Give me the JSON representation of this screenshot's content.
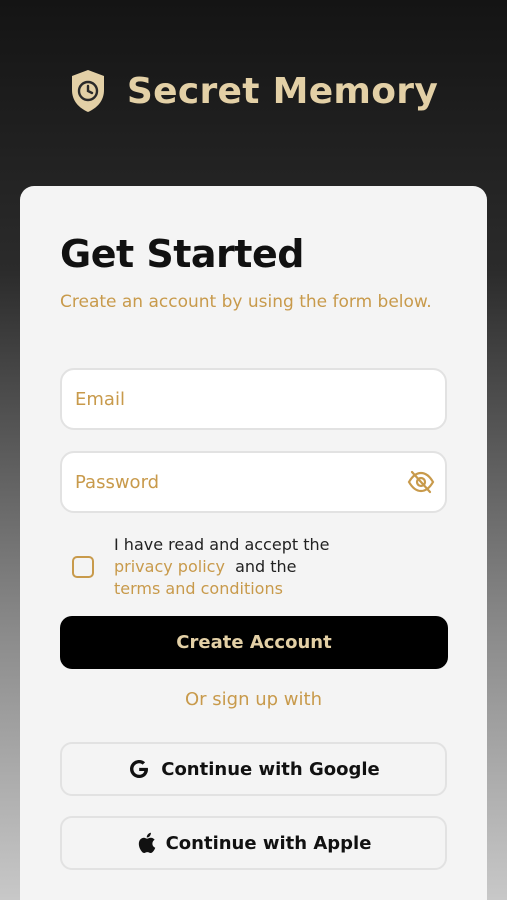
{
  "app": {
    "title": "Secret Memory",
    "logo_icon": "shield-clock-icon",
    "brand_color": "#e3d0a6",
    "accent_color": "#c89a4b"
  },
  "form": {
    "heading": "Get Started",
    "subtitle": "Create an account by using the form below.",
    "email": {
      "value": "",
      "placeholder": "Email"
    },
    "password": {
      "value": "",
      "placeholder": "Password",
      "toggle_icon": "eye-off-icon"
    },
    "terms": {
      "prefix": "I have read and accept the",
      "privacy_link": "privacy policy",
      "middle": "and the",
      "terms_link": "terms and conditions",
      "checked": false
    },
    "create_button": "Create Account",
    "divider_text": "Or sign up with",
    "google_button": {
      "label": "Continue with Google",
      "icon": "google-icon"
    },
    "apple_button": {
      "label": "Continue with Apple",
      "icon": "apple-icon"
    }
  }
}
